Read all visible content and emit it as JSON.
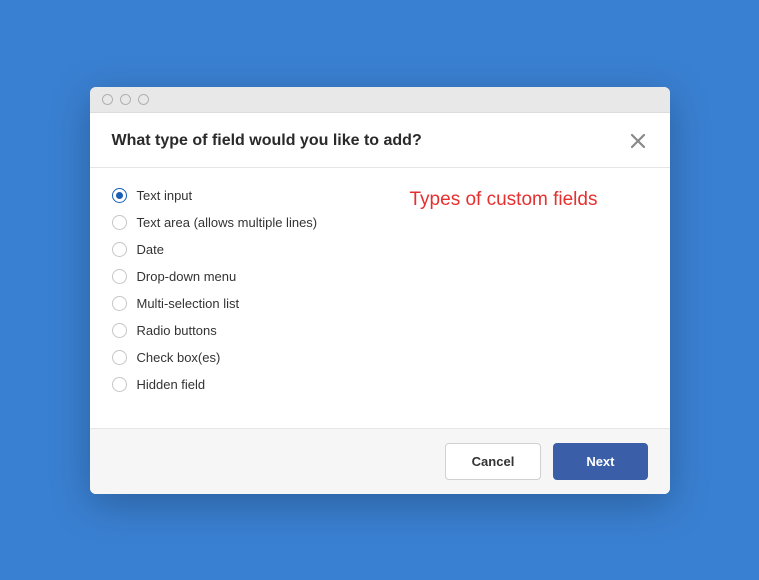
{
  "dialog": {
    "title": "What type of field would you like to add?",
    "annotation": "Types of custom fields",
    "options": [
      {
        "label": "Text input",
        "selected": true
      },
      {
        "label": "Text area (allows multiple lines)",
        "selected": false
      },
      {
        "label": "Date",
        "selected": false
      },
      {
        "label": "Drop-down menu",
        "selected": false
      },
      {
        "label": "Multi-selection list",
        "selected": false
      },
      {
        "label": "Radio buttons",
        "selected": false
      },
      {
        "label": "Check box(es)",
        "selected": false
      },
      {
        "label": "Hidden field",
        "selected": false
      }
    ],
    "buttons": {
      "cancel": "Cancel",
      "next": "Next"
    }
  }
}
